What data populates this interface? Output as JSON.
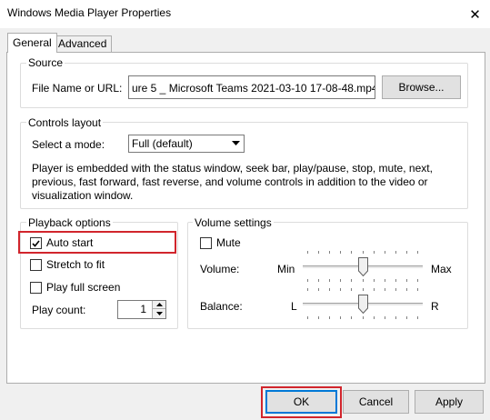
{
  "window": {
    "title": "Windows Media Player Properties",
    "close_symbol": "✕"
  },
  "tabs": [
    {
      "label": "General",
      "active": true
    },
    {
      "label": "Advanced",
      "active": false
    }
  ],
  "source": {
    "group_label": "Source",
    "file_label": "File Name or URL:",
    "file_value": "ure 5 _ Microsoft Teams 2021-03-10 17-08-48.mp4",
    "browse_label": "Browse..."
  },
  "controls_layout": {
    "group_label": "Controls layout",
    "mode_label": "Select a mode:",
    "mode_value": "Full (default)",
    "description": "Player is embedded with the status window, seek bar, play/pause, stop, mute, next, previous, fast forward, fast reverse, and volume controls in addition to the video or visualization window."
  },
  "playback": {
    "group_label": "Playback options",
    "auto_start": {
      "label": "Auto start",
      "checked": true
    },
    "stretch": {
      "label": "Stretch to fit",
      "checked": false
    },
    "full_screen": {
      "label": "Play full screen",
      "checked": false
    },
    "play_count_label": "Play count:",
    "play_count_value": "1"
  },
  "volume": {
    "group_label": "Volume settings",
    "mute": {
      "label": "Mute",
      "checked": false
    },
    "volume_label": "Volume:",
    "volume_min": "Min",
    "volume_max": "Max",
    "volume_level": 0.5,
    "balance_label": "Balance:",
    "balance_left": "L",
    "balance_right": "R",
    "balance_level": 0.5
  },
  "buttons": {
    "ok": "OK",
    "cancel": "Cancel",
    "apply": "Apply"
  },
  "colors": {
    "highlight": "#d1252c",
    "accent": "#0078d7"
  }
}
